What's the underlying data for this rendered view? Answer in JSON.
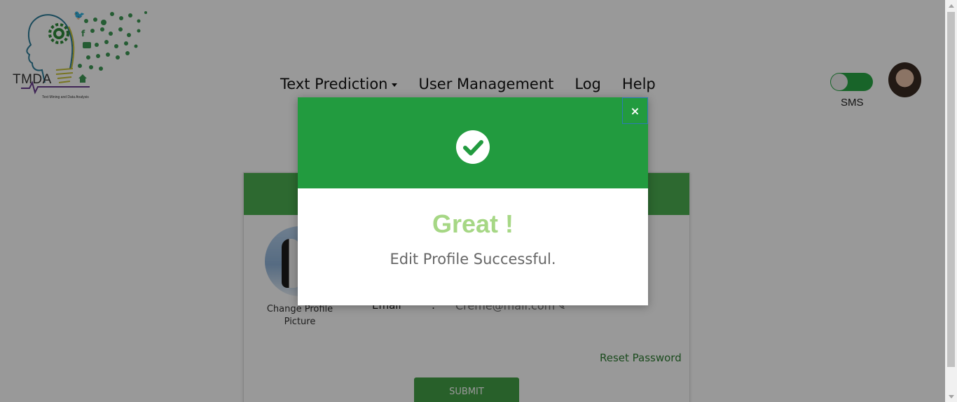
{
  "logo": {
    "title": "TMDA",
    "subtitle": "Text Mining and Data Analysis"
  },
  "nav": {
    "text_prediction": "Text Prediction",
    "user_management": "User Management",
    "log": "Log",
    "help": "Help"
  },
  "header": {
    "sms_label": "SMS",
    "sms_enabled": true
  },
  "profile": {
    "change_picture": "Change Profile Picture",
    "email_label": "Email",
    "email_colon": ":",
    "email_value": "Creme@mail.com",
    "reset_password": "Reset Password",
    "submit": "SUBMIT"
  },
  "modal": {
    "title": "Great !",
    "message": "Edit Profile Successful.",
    "close": "×",
    "icon": "check-circle-icon"
  },
  "colors": {
    "modal_header": "#229b3f",
    "title_green": "#a6d785",
    "toggle_green": "#28a745"
  }
}
